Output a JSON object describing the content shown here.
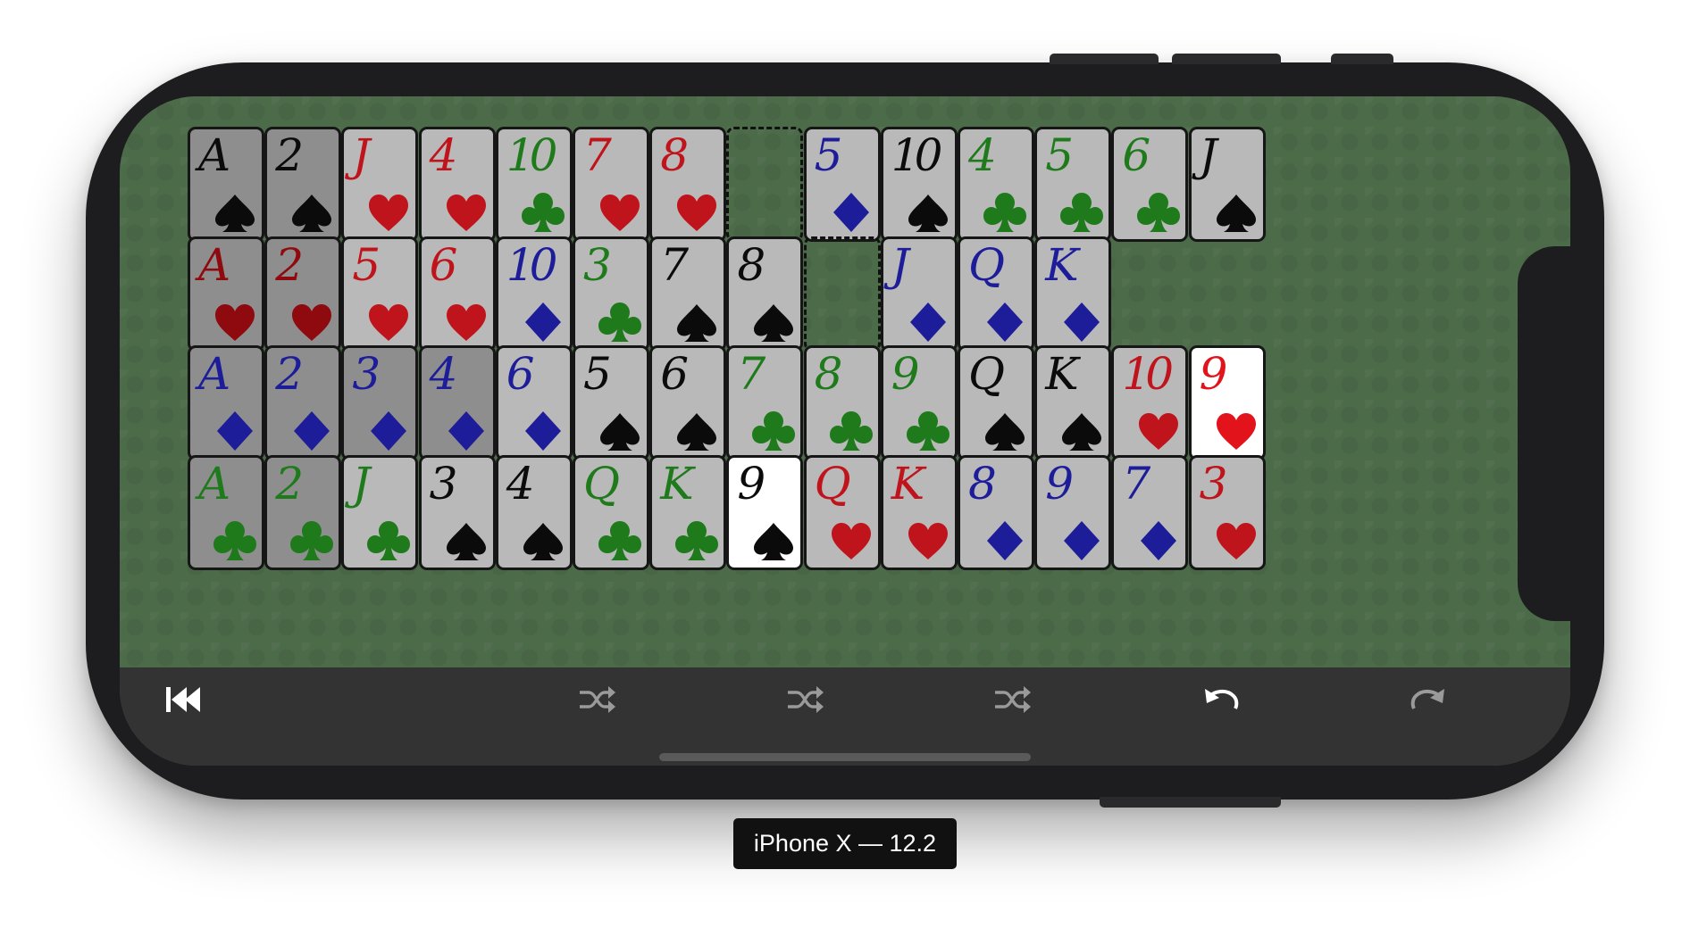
{
  "device_label": "iPhone X — 12.2",
  "colors": {
    "felt": "#4c6b49",
    "toolbar": "#333333",
    "red": "#c0141c",
    "black": "#0b0b0b",
    "green": "#1f7a1c",
    "blue": "#1d1d9a"
  },
  "board": {
    "rows": [
      [
        {
          "rank": "A",
          "suit": "spade",
          "state": "dim"
        },
        {
          "rank": "2",
          "suit": "spade",
          "state": "dim"
        },
        {
          "rank": "J",
          "suit": "heart",
          "state": "normal"
        },
        {
          "rank": "4",
          "suit": "heart",
          "state": "normal"
        },
        {
          "rank": "10",
          "suit": "club",
          "state": "normal"
        },
        {
          "rank": "7",
          "suit": "heart",
          "state": "normal"
        },
        {
          "rank": "8",
          "suit": "heart",
          "state": "normal"
        },
        {
          "rank": "",
          "suit": "",
          "state": "empty"
        },
        {
          "rank": "5",
          "suit": "diamond",
          "state": "normal"
        },
        {
          "rank": "10",
          "suit": "spade",
          "state": "normal"
        },
        {
          "rank": "4",
          "suit": "club",
          "state": "normal"
        },
        {
          "rank": "5",
          "suit": "club",
          "state": "normal"
        },
        {
          "rank": "6",
          "suit": "club",
          "state": "normal"
        },
        {
          "rank": "J",
          "suit": "spade",
          "state": "normal"
        }
      ],
      [
        {
          "rank": "A",
          "suit": "heart",
          "state": "dim"
        },
        {
          "rank": "2",
          "suit": "heart",
          "state": "dim"
        },
        {
          "rank": "5",
          "suit": "heart",
          "state": "normal"
        },
        {
          "rank": "6",
          "suit": "heart",
          "state": "normal"
        },
        {
          "rank": "10",
          "suit": "diamond",
          "state": "normal"
        },
        {
          "rank": "3",
          "suit": "club",
          "state": "normal"
        },
        {
          "rank": "7",
          "suit": "spade",
          "state": "normal"
        },
        {
          "rank": "8",
          "suit": "spade",
          "state": "normal"
        },
        {
          "rank": "",
          "suit": "",
          "state": "empty"
        },
        {
          "rank": "J",
          "suit": "diamond",
          "state": "normal"
        },
        {
          "rank": "Q",
          "suit": "diamond",
          "state": "normal"
        },
        {
          "rank": "K",
          "suit": "diamond",
          "state": "normal"
        },
        {
          "rank": "",
          "suit": "",
          "state": "none"
        },
        {
          "rank": "",
          "suit": "",
          "state": "none"
        }
      ],
      [
        {
          "rank": "A",
          "suit": "diamond",
          "state": "dim"
        },
        {
          "rank": "2",
          "suit": "diamond",
          "state": "dim"
        },
        {
          "rank": "3",
          "suit": "diamond",
          "state": "dim"
        },
        {
          "rank": "4",
          "suit": "diamond",
          "state": "dim"
        },
        {
          "rank": "6",
          "suit": "diamond",
          "state": "normal"
        },
        {
          "rank": "5",
          "suit": "spade",
          "state": "normal"
        },
        {
          "rank": "6",
          "suit": "spade",
          "state": "normal"
        },
        {
          "rank": "7",
          "suit": "club",
          "state": "normal"
        },
        {
          "rank": "8",
          "suit": "club",
          "state": "normal"
        },
        {
          "rank": "9",
          "suit": "club",
          "state": "normal"
        },
        {
          "rank": "Q",
          "suit": "spade",
          "state": "normal"
        },
        {
          "rank": "K",
          "suit": "spade",
          "state": "normal"
        },
        {
          "rank": "10",
          "suit": "heart",
          "state": "normal"
        },
        {
          "rank": "9",
          "suit": "heart",
          "state": "highlight"
        }
      ],
      [
        {
          "rank": "A",
          "suit": "club",
          "state": "dim"
        },
        {
          "rank": "2",
          "suit": "club",
          "state": "dim"
        },
        {
          "rank": "J",
          "suit": "club",
          "state": "normal"
        },
        {
          "rank": "3",
          "suit": "spade",
          "state": "normal"
        },
        {
          "rank": "4",
          "suit": "spade",
          "state": "normal"
        },
        {
          "rank": "Q",
          "suit": "club",
          "state": "normal"
        },
        {
          "rank": "K",
          "suit": "club",
          "state": "normal"
        },
        {
          "rank": "9",
          "suit": "spade",
          "state": "highlight"
        },
        {
          "rank": "Q",
          "suit": "heart",
          "state": "normal"
        },
        {
          "rank": "K",
          "suit": "heart",
          "state": "normal"
        },
        {
          "rank": "8",
          "suit": "diamond",
          "state": "normal"
        },
        {
          "rank": "9",
          "suit": "diamond",
          "state": "normal"
        },
        {
          "rank": "7",
          "suit": "diamond",
          "state": "normal"
        },
        {
          "rank": "3",
          "suit": "heart",
          "state": "normal"
        }
      ]
    ]
  },
  "toolbar": [
    {
      "icon": "restart-icon",
      "name": "restart-button",
      "enabled": true
    },
    {
      "icon": "shuffle-icon",
      "name": "shuffle-button-1",
      "enabled": false
    },
    {
      "icon": "shuffle-icon",
      "name": "shuffle-button-2",
      "enabled": false
    },
    {
      "icon": "shuffle-icon",
      "name": "shuffle-button-3",
      "enabled": false
    },
    {
      "icon": "undo-icon",
      "name": "undo-button",
      "enabled": true
    },
    {
      "icon": "redo-icon",
      "name": "redo-button",
      "enabled": false
    }
  ]
}
